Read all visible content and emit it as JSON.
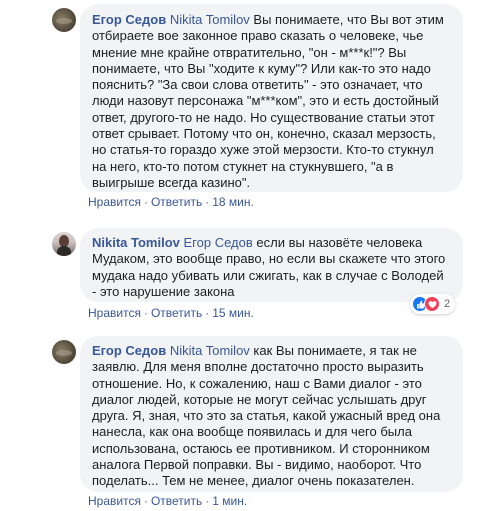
{
  "comments": [
    {
      "author": "Егор Седов",
      "mention": "Nikita Tomilov",
      "text": [
        " Вы понимаете, что Вы вот этим",
        "отбираете вое законное право сказать о человеке, чье",
        "мнение мне крайне отвратительно, \"он - м***к!\"? Вы",
        "понимаете, что Вы \"ходите к куму\"? Или как-то это надо",
        "пояснить? \"За свои слова ответить\" - это означает, что",
        "люди назовут персонажа \"м***ком\", это и есть достойный",
        "ответ, другого-то не надо. Но существование статьи этот",
        "ответ срывает. Потому что он, конечно, сказал мерзость,",
        "но статья-то гораздо хуже этой мерзости. Кто-то стукнул",
        "на него, кто-то потом стукнет на стукнувшего, \"а в",
        "выигрыше всегда казино\"."
      ],
      "actions": {
        "like": "Нравится",
        "reply": "Ответить",
        "time": "18 мин."
      }
    },
    {
      "author": "Nikita Tomilov",
      "mention": "Егор Седов",
      "text": [
        " если вы назовёте человека",
        "Мудаком, это вообще право, но если вы скажете что этого",
        "мудака надо убивать или сжигать, как в случае с Володей",
        "- это нарушение закона"
      ],
      "reactions": {
        "count": "2",
        "icons": [
          "like-icon",
          "love-icon"
        ]
      },
      "actions": {
        "like": "Нравится",
        "reply": "Ответить",
        "time": "15 мин."
      }
    },
    {
      "author": "Егор Седов",
      "mention": "Nikita Tomilov",
      "text": [
        " как Вы понимаете, я так не",
        "заявлю. Для меня вполне достаточно просто выразить",
        "отношение. Но, к сожалению, наш с Вами диалог - это",
        "диалог людей, которые не могут сейчас услышать друг",
        "друга. Я, зная, что это за статья, какой ужасный вред она",
        "нанесла, как она вообще появилась и для чего была",
        "использована, остаюсь ее противником. И сторонником",
        "аналога Первой поправки. Вы - видимо, наоборот. Что",
        "поделать... Тем не менее, диалог очень показателен."
      ],
      "actions": {
        "like": "Нравится",
        "reply": "Ответить",
        "time": "1 мин."
      }
    }
  ]
}
